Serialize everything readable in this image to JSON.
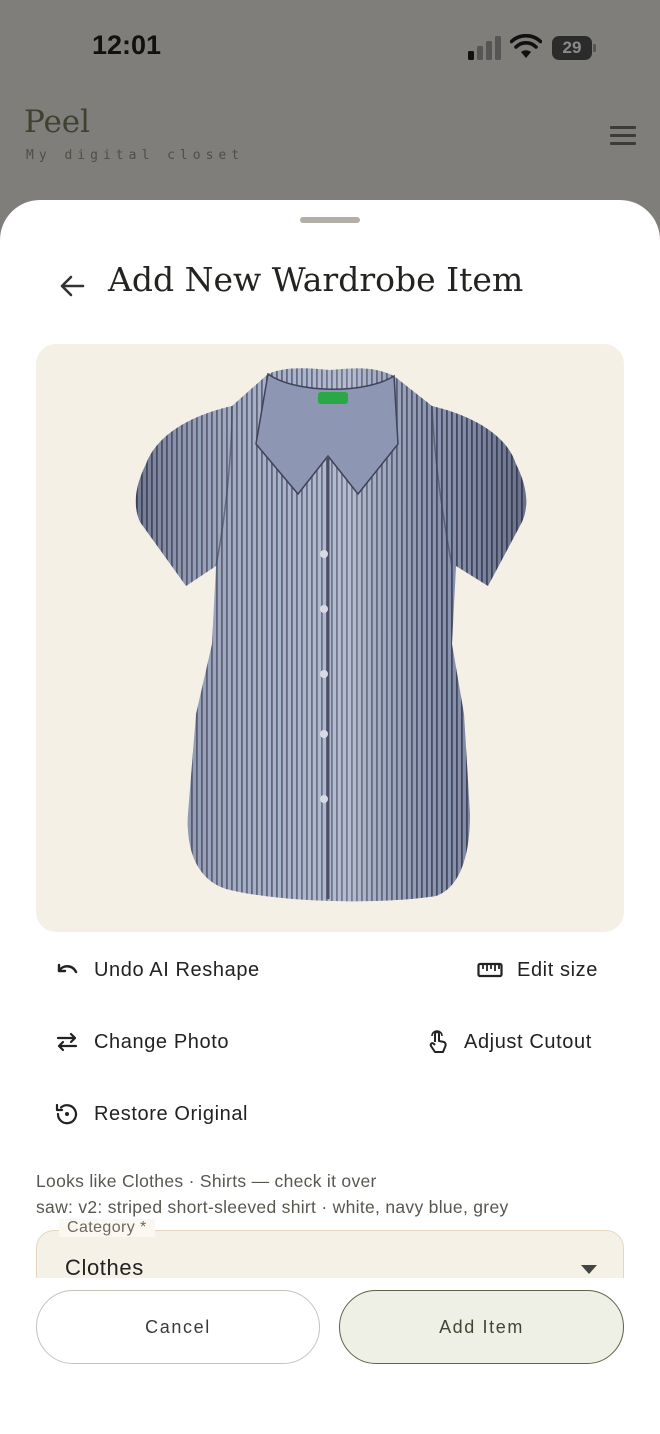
{
  "status_bar": {
    "time": "12:01",
    "battery": "29",
    "icons": [
      "signal-icon",
      "wifi-icon",
      "battery-icon"
    ]
  },
  "app_header": {
    "brand": "Peel",
    "tagline": "My digital closet",
    "menu_icon": "hamburger-menu-icon"
  },
  "sheet": {
    "back_icon": "arrow-left-icon",
    "title": "Add New Wardrobe Item",
    "actions": {
      "undo_reshape": "Undo AI Reshape",
      "edit_size": "Edit size",
      "change_photo": "Change Photo",
      "adjust_cutout": "Adjust Cutout",
      "restore_original": "Restore Original"
    },
    "hint_line1": "Looks like Clothes · Shirts — check it over",
    "hint_line2": "saw: v2: striped short-sleeved shirt · white, navy blue, grey",
    "category": {
      "label": "Category *",
      "value": "Clothes"
    },
    "buttons": {
      "cancel": "Cancel",
      "add": "Add Item"
    }
  },
  "colors": {
    "overlay": "#7f7e7a",
    "card_bg": "#f5f0e6",
    "accent": "#5d6347",
    "accent_bg": "#eef0e6"
  }
}
